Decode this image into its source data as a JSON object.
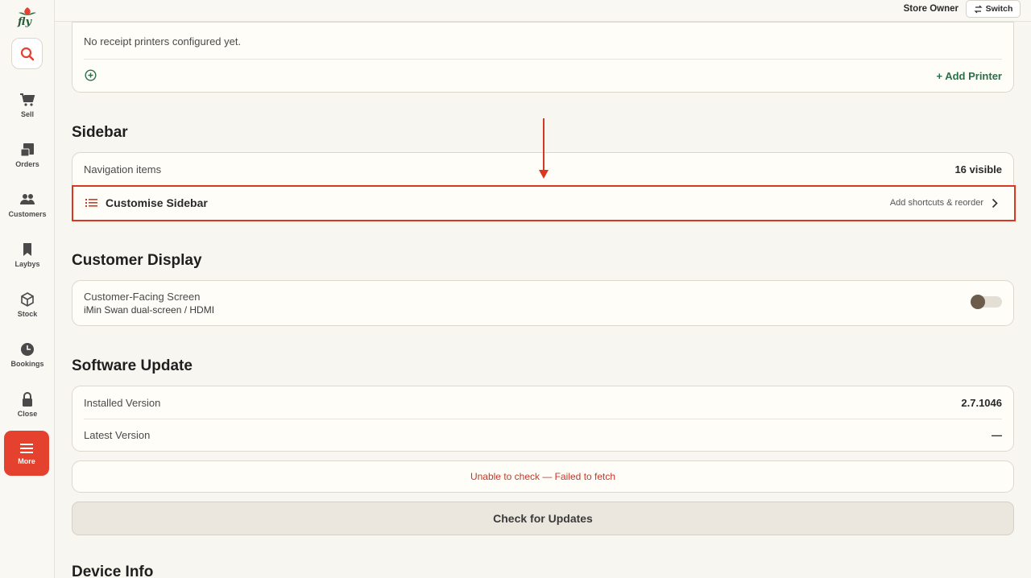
{
  "app": {
    "logo_text": "fly"
  },
  "topbar": {
    "user_role": "Store Owner",
    "switch_label": "Switch"
  },
  "sidebar": {
    "items": [
      {
        "label": "Sell",
        "icon": "cart-icon"
      },
      {
        "label": "Orders",
        "icon": "orders-icon"
      },
      {
        "label": "Customers",
        "icon": "customers-icon"
      },
      {
        "label": "Laybys",
        "icon": "bookmark-icon"
      },
      {
        "label": "Stock",
        "icon": "box-icon"
      },
      {
        "label": "Bookings",
        "icon": "clock-icon"
      },
      {
        "label": "Close",
        "icon": "lock-icon"
      },
      {
        "label": "More",
        "icon": "menu-icon",
        "active": true
      }
    ]
  },
  "printers": {
    "empty_text": "No receipt printers configured yet.",
    "add_label": "+ Add Printer"
  },
  "sidebar_section": {
    "title": "Sidebar",
    "nav_items_label": "Navigation items",
    "nav_items_value": "16 visible",
    "customise_label": "Customise Sidebar",
    "customise_hint": "Add shortcuts & reorder"
  },
  "customer_display": {
    "title": "Customer Display",
    "screen_label": "Customer-Facing Screen",
    "screen_sub": "iMin Swan dual-screen / HDMI",
    "enabled": false
  },
  "software_update": {
    "title": "Software Update",
    "installed_label": "Installed Version",
    "installed_value": "2.7.1046",
    "latest_label": "Latest Version",
    "latest_value": "—",
    "error_text": "Unable to check — Failed to fetch",
    "check_label": "Check for Updates"
  },
  "device_info": {
    "title": "Device Info"
  },
  "colors": {
    "accent": "#e4412f",
    "brand_green": "#2c6e49",
    "error": "#c0392b"
  }
}
